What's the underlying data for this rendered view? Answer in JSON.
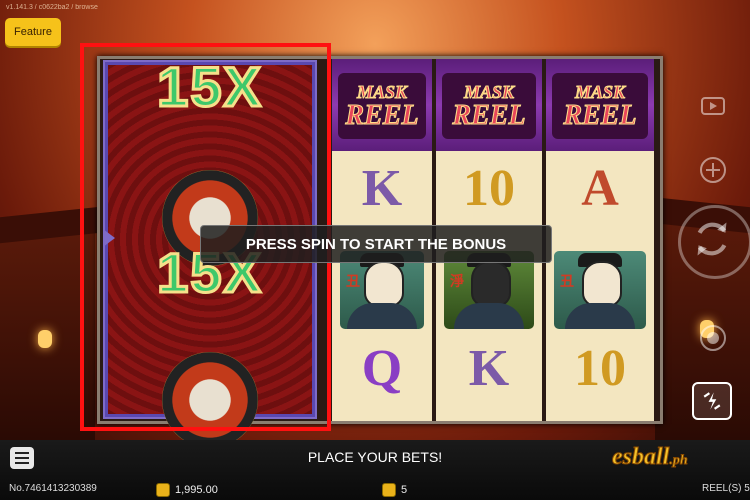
{
  "header": {
    "version": "v1.141.3 / c0622ba2 / browse",
    "feature_label": "Feature"
  },
  "bonus_reel": {
    "multipliers": [
      "15X",
      "15X"
    ]
  },
  "reels": {
    "header_tile": {
      "line1": "MASK",
      "line2": "REEL"
    },
    "reel2": {
      "top": "K",
      "bottom": "Q",
      "char_glyph": "丑"
    },
    "reel3": {
      "top": "10",
      "bottom": "K",
      "char_glyph": "淨"
    },
    "reel4": {
      "top": "A",
      "bottom": "10",
      "char_glyph": "丑"
    }
  },
  "message": "PRESS SPIN TO START THE BONUS",
  "bottom_bar": {
    "status": "PLACE YOUR BETS!",
    "round_no": "No.7461413230389",
    "balance": "1,995.00",
    "bet": "5",
    "reel_count": "REEL(S) 5"
  },
  "logo": {
    "main": "esball",
    "suffix": ".ph"
  },
  "colors": {
    "highlight_box": "#ff1111",
    "feature_button": "#f6c21a",
    "multiplier": "#3ec86a"
  },
  "icons": [
    "menu-icon",
    "replay-icon",
    "autoplay-icon",
    "spin-icon",
    "stop-icon",
    "turbo-icon",
    "coin-icon"
  ]
}
